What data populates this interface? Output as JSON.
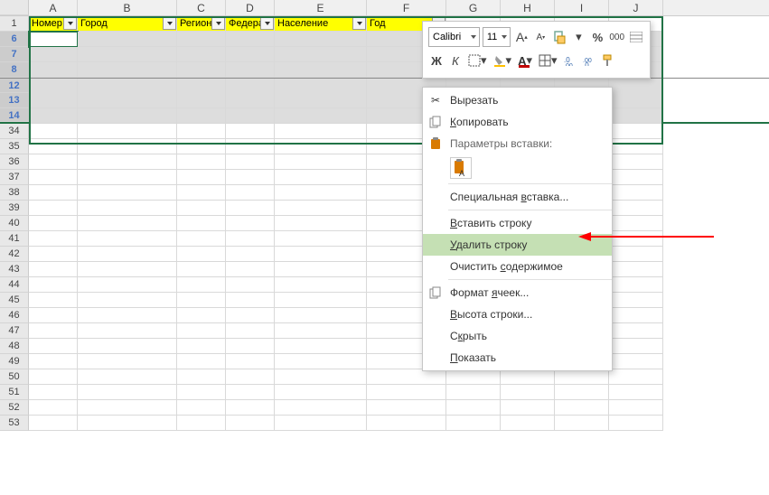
{
  "columns": [
    {
      "letter": "A",
      "width": 54
    },
    {
      "letter": "B",
      "width": 110
    },
    {
      "letter": "C",
      "width": 54
    },
    {
      "letter": "D",
      "width": 54
    },
    {
      "letter": "E",
      "width": 102
    },
    {
      "letter": "F",
      "width": 88
    },
    {
      "letter": "G",
      "width": 60
    },
    {
      "letter": "H",
      "width": 60
    },
    {
      "letter": "I",
      "width": 60
    },
    {
      "letter": "J",
      "width": 60
    }
  ],
  "headers": [
    "Номер",
    "Город",
    "Регион",
    "Федера",
    "Население",
    "Год"
  ],
  "selected_rows": [
    "6",
    "7",
    "8",
    "12",
    "13",
    "14"
  ],
  "remaining_rows": [
    "34",
    "35",
    "36",
    "37",
    "38",
    "39",
    "40",
    "41",
    "42",
    "43",
    "44",
    "45",
    "46",
    "47",
    "48",
    "49",
    "50",
    "51",
    "52",
    "53"
  ],
  "mini_toolbar": {
    "font": "Calibri",
    "size": "11",
    "buttons_row1": [
      "A",
      "A",
      "format-painter",
      "percent",
      "thousands",
      "borders"
    ],
    "bold": "Ж",
    "italic": "К",
    "buttons_row2": [
      "font-color",
      "fill-color",
      "borders",
      "merge",
      "align",
      "clear"
    ]
  },
  "context_menu": {
    "cut": "Вырезать",
    "copy": "Копировать",
    "paste_options": "Параметры вставки:",
    "paste_special": "Специальная вставка...",
    "insert_row": "Вставить строку",
    "delete_row": "Удалить строку",
    "clear": "Очистить содержимое",
    "format_cells": "Формат ячеек...",
    "row_height": "Высота строки...",
    "hide": "Скрыть",
    "show": "Показать"
  },
  "chart_data": null
}
